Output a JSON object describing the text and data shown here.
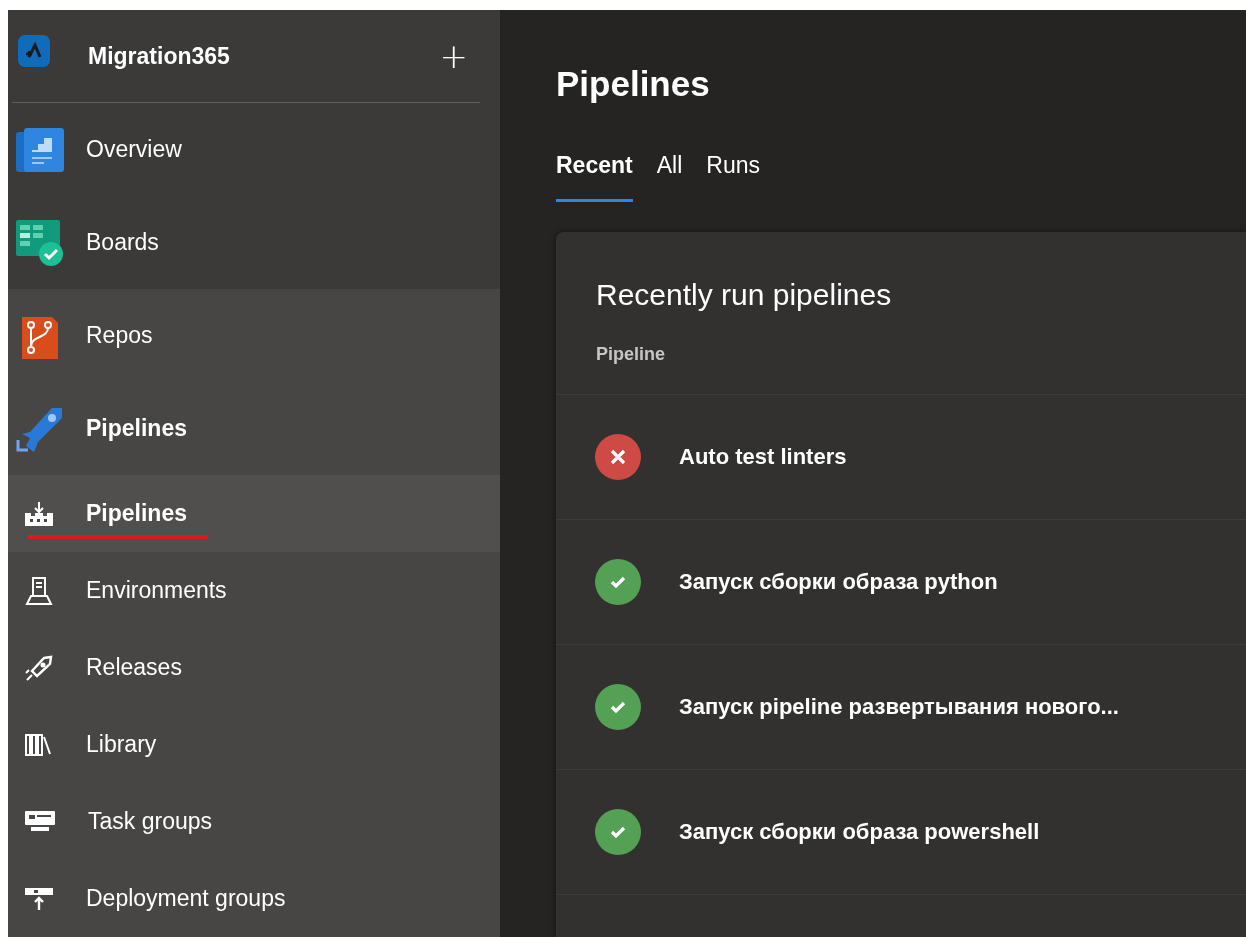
{
  "project": {
    "name": "Migration365",
    "add_label": "+"
  },
  "sidebar": {
    "items": [
      {
        "label": "Overview",
        "expanded": false
      },
      {
        "label": "Boards",
        "expanded": false
      },
      {
        "label": "Repos",
        "expanded": false
      },
      {
        "label": "Pipelines",
        "expanded": true,
        "children": [
          {
            "label": "Pipelines",
            "selected": true
          },
          {
            "label": "Environments",
            "selected": false
          },
          {
            "label": "Releases",
            "selected": false
          },
          {
            "label": "Library",
            "selected": false
          },
          {
            "label": "Task groups",
            "selected": false
          },
          {
            "label": "Deployment groups",
            "selected": false
          }
        ]
      }
    ]
  },
  "page": {
    "title": "Pipelines",
    "tabs": [
      {
        "label": "Recent",
        "selected": true
      },
      {
        "label": "All",
        "selected": false
      },
      {
        "label": "Runs",
        "selected": false
      }
    ],
    "card": {
      "title": "Recently run pipelines",
      "columns": [
        "Pipeline"
      ],
      "rows": [
        {
          "failed": true,
          "name": "Auto test linters"
        },
        {
          "failed": false,
          "name": "Запуск сборки образа python"
        },
        {
          "failed": false,
          "name": "Запуск pipeline развертывания нового..."
        },
        {
          "failed": false,
          "name": "Запуск сборки образа powershell"
        }
      ]
    }
  }
}
